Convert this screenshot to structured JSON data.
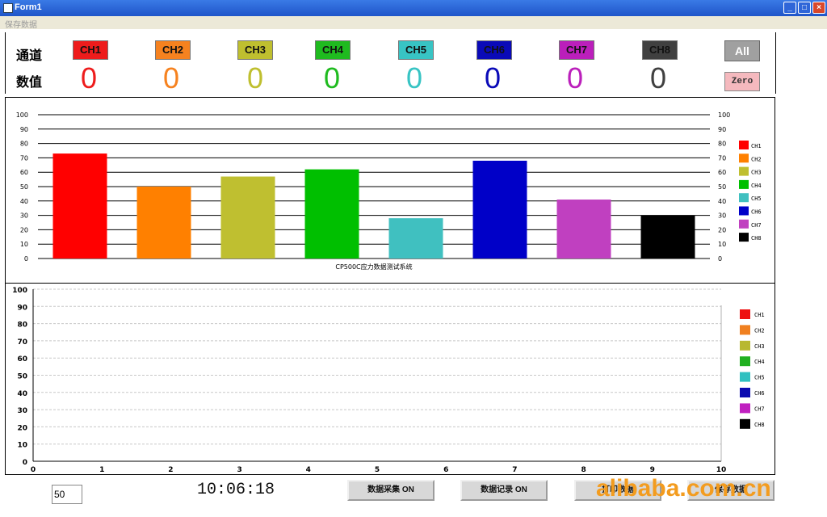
{
  "window": {
    "title": "Form1",
    "minimize": "_",
    "maximize": "□",
    "close": "×"
  },
  "menu": {
    "label": "保存数据"
  },
  "labels": {
    "channel": "通道",
    "value": "数值"
  },
  "channels": [
    {
      "label": "CH1",
      "color": "#ee1c1c",
      "value": "0"
    },
    {
      "label": "CH2",
      "color": "#f6821f",
      "value": "0"
    },
    {
      "label": "CH3",
      "color": "#bfbf2f",
      "value": "0"
    },
    {
      "label": "CH4",
      "color": "#1fbb1f",
      "value": "0"
    },
    {
      "label": "CH5",
      "color": "#38c4c4",
      "value": "0"
    },
    {
      "label": "CH6",
      "color": "#0a0ab8",
      "value": "0"
    },
    {
      "label": "CH7",
      "color": "#bb1fbb",
      "value": "0"
    },
    {
      "label": "CH8",
      "color": "#404040",
      "value": "0"
    }
  ],
  "buttons": {
    "all": "All",
    "zero": "Zero"
  },
  "bottom": {
    "input_value": "50",
    "clock": "10:06:18",
    "collect_button": "数据采集 ON",
    "record_button": "数据记录 ON",
    "print_button": "打印数据",
    "save_button": "保存数据"
  },
  "watermark": "alibaba.com.cn",
  "chart_data": [
    {
      "type": "bar",
      "xlabel": "CP500C应力数据测试系统",
      "ylim": [
        0,
        100
      ],
      "yticks": [
        0,
        10,
        20,
        30,
        40,
        50,
        60,
        70,
        80,
        90,
        100
      ],
      "categories": [
        "CH1",
        "CH2",
        "CH3",
        "CH4",
        "CH5",
        "CH6",
        "CH7",
        "CH8"
      ],
      "values": [
        73,
        50,
        57,
        62,
        28,
        68,
        41,
        30
      ],
      "colors": [
        "#ff0000",
        "#ff8000",
        "#bfbf30",
        "#00bf00",
        "#40c0c0",
        "#0000c8",
        "#c040c0",
        "#000000"
      ],
      "legend": [
        "CH1",
        "CH2",
        "CH3",
        "CH4",
        "CH5",
        "CH6",
        "CH7",
        "CH8"
      ],
      "legend_placement": "right",
      "grid": true
    },
    {
      "type": "line",
      "xlim": [
        0,
        10
      ],
      "ylim": [
        0,
        100
      ],
      "xticks": [
        0,
        1,
        2,
        3,
        4,
        5,
        6,
        7,
        8,
        9,
        10
      ],
      "yticks": [
        0,
        10,
        20,
        30,
        40,
        50,
        60,
        70,
        80,
        90,
        100
      ],
      "series": [],
      "legend": [
        "CH1",
        "CH2",
        "CH3",
        "CH4",
        "CH5",
        "CH6",
        "CH7",
        "CH8"
      ],
      "legend_colors": [
        "#e11",
        "#f08020",
        "#b8b830",
        "#20b020",
        "#30c0c0",
        "#0a0ab0",
        "#c020c0",
        "#000000"
      ],
      "legend_placement": "right",
      "grid": true
    }
  ]
}
